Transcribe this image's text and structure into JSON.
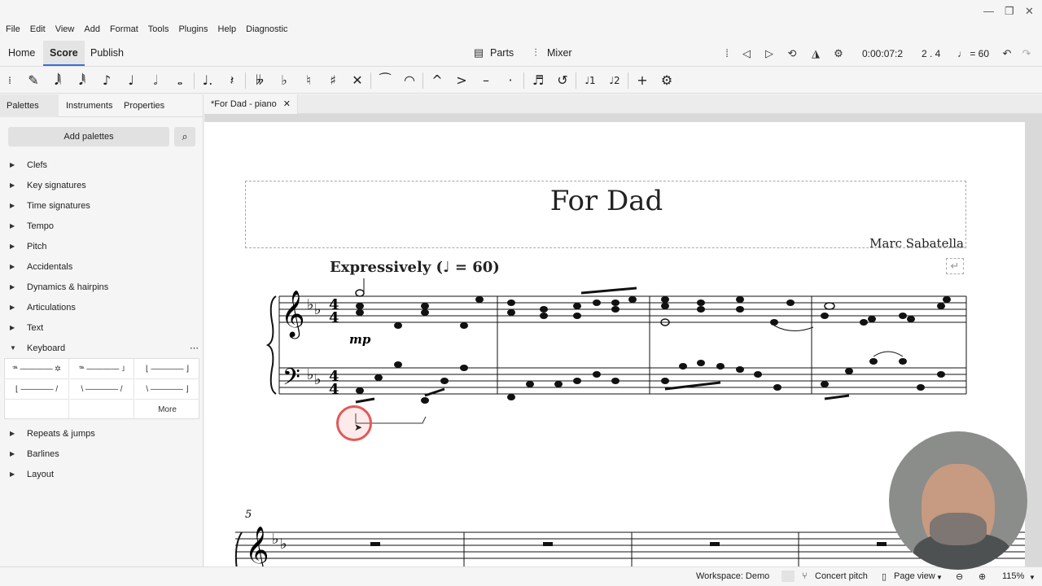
{
  "menu": [
    "File",
    "Edit",
    "View",
    "Add",
    "Format",
    "Tools",
    "Plugins",
    "Help",
    "Diagnostic"
  ],
  "workspace_tabs": [
    {
      "label": "Home",
      "active": false
    },
    {
      "label": "Score",
      "active": true
    },
    {
      "label": "Publish",
      "active": false
    }
  ],
  "top": {
    "parts_label": "Parts",
    "mixer_label": "Mixer",
    "time": "0:00:07:2",
    "position": "2 . 4",
    "tempo": "= 60"
  },
  "left_panel": {
    "tabs": [
      "Palettes",
      "Instruments",
      "Properties"
    ],
    "add_palettes": "Add palettes",
    "palettes": [
      {
        "label": "Clefs",
        "expanded": false
      },
      {
        "label": "Key signatures",
        "expanded": false
      },
      {
        "label": "Time signatures",
        "expanded": false
      },
      {
        "label": "Tempo",
        "expanded": false
      },
      {
        "label": "Pitch",
        "expanded": false
      },
      {
        "label": "Accidentals",
        "expanded": false
      },
      {
        "label": "Dynamics & hairpins",
        "expanded": false
      },
      {
        "label": "Articulations",
        "expanded": false
      },
      {
        "label": "Text",
        "expanded": false
      },
      {
        "label": "Keyboard",
        "expanded": true
      }
    ],
    "keyboard_more": "More",
    "palettes_after": [
      {
        "label": "Repeats & jumps",
        "expanded": false
      },
      {
        "label": "Barlines",
        "expanded": false
      },
      {
        "label": "Layout",
        "expanded": false
      }
    ]
  },
  "document_tab": "*For Dad - piano",
  "score": {
    "title": "For Dad",
    "composer": "Marc Sabatella",
    "tempo_text": "Expressively (",
    "tempo_value": "= 60)",
    "dynamic": "mp",
    "system2_measure": "5"
  },
  "status": {
    "workspace": "Workspace: Demo",
    "concert_pitch": "Concert pitch",
    "view_mode": "Page view",
    "zoom": "115%"
  }
}
